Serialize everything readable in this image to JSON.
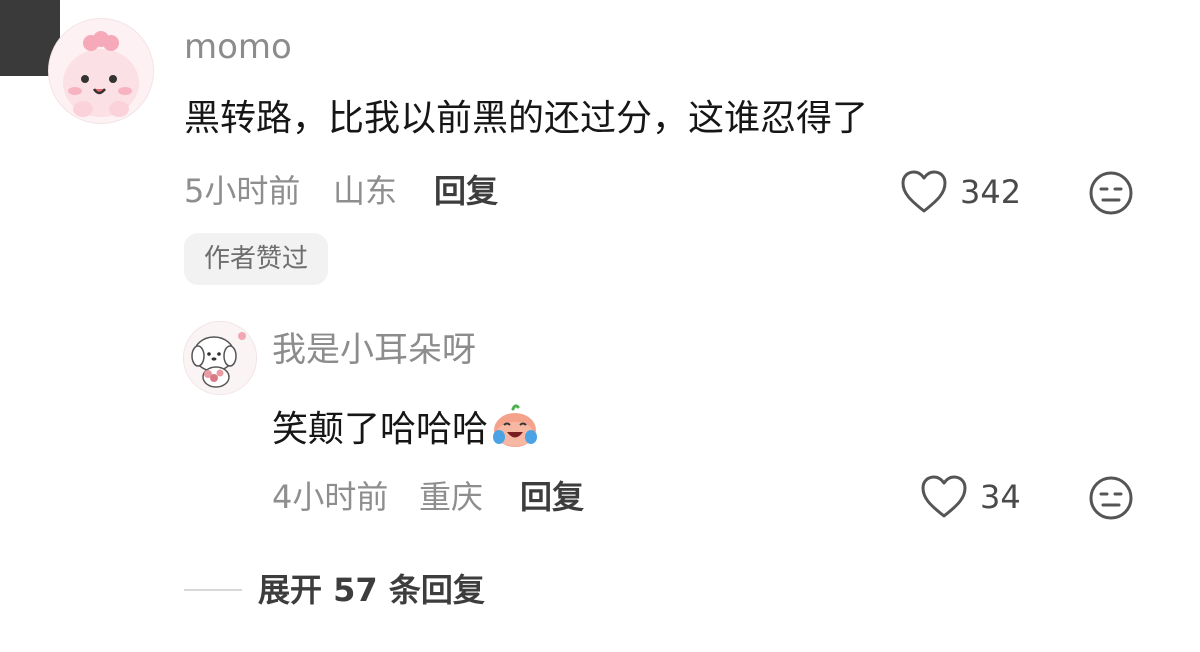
{
  "comment": {
    "username": "momo",
    "text": "黑转路，比我以前黑的还过分，这谁忍得了",
    "time": "5小时前",
    "location": "山东",
    "reply_label": "回复",
    "likes": "342",
    "author_badge": "作者赞过"
  },
  "reply": {
    "username": "我是小耳朵呀",
    "text": "笑颠了哈哈哈",
    "emoji": "laugh-cry-emoji",
    "time": "4小时前",
    "location": "重庆",
    "reply_label": "回复",
    "likes": "34"
  },
  "expand": {
    "label": "展开 57 条回复"
  },
  "icons": {
    "like": "heart-icon",
    "dislike": "meh-face-icon"
  },
  "colors": {
    "username": "#8c8c8c",
    "text": "#161616",
    "meta": "#8e8e8e",
    "badge_bg": "#f2f2f2"
  }
}
